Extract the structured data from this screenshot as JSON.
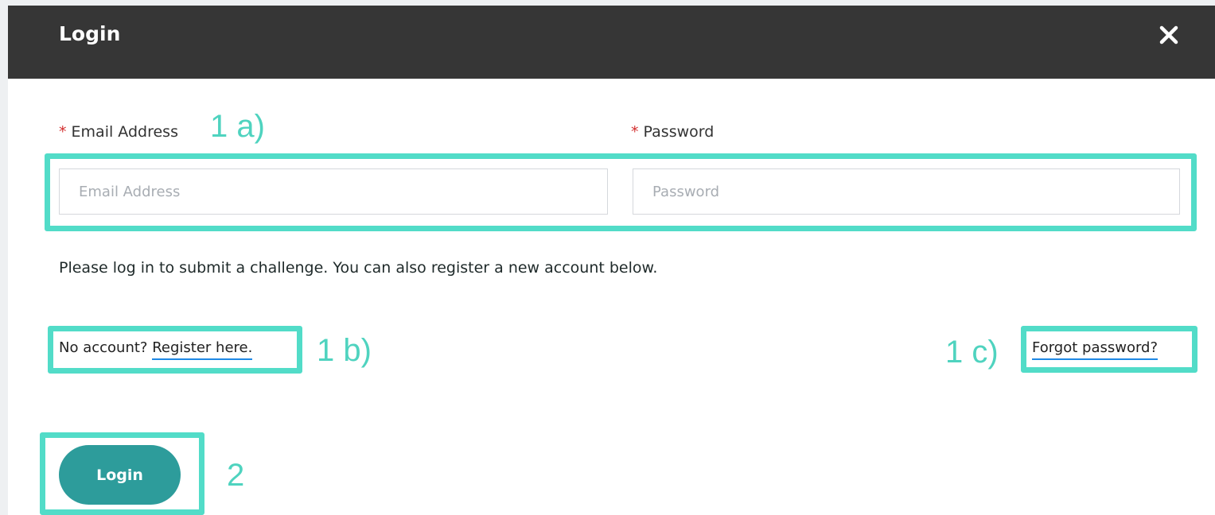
{
  "header": {
    "title": "Login",
    "close_icon": "close-icon"
  },
  "form": {
    "required_mark": "*",
    "email_label": "Email Address",
    "email_placeholder": "Email Address",
    "email_value": "",
    "password_label": "Password",
    "password_placeholder": "Password",
    "password_value": ""
  },
  "info_text": "Please log in to submit a challenge. You can also register a new account below.",
  "register": {
    "prefix": "No account?",
    "link": "Register here."
  },
  "forgot_password": "Forgot password?",
  "login_button": "Login",
  "annotations": {
    "fields": "1 a)",
    "register": "1 b)",
    "forgot": "1 c)",
    "login": "2"
  },
  "colors": {
    "header_bg": "#363636",
    "accent_button": "#2d9c9b",
    "annotation": "#52dcc8",
    "required": "#d32f2f",
    "link_underline": "#1e88e5"
  }
}
